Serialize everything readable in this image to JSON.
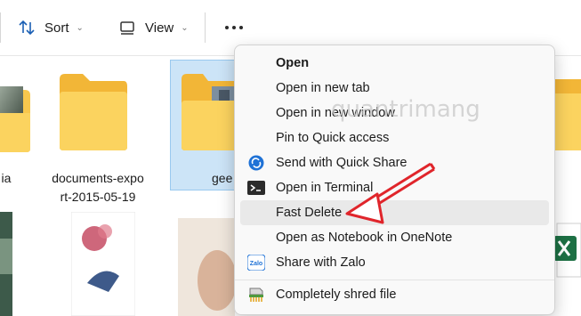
{
  "toolbar": {
    "sort_label": "Sort",
    "view_label": "View",
    "sort_icon": "sort-arrows-icon",
    "view_icon": "view-layout-icon",
    "more_icon": "more-options-icon"
  },
  "files": {
    "left_partial_name": "ia",
    "documents_name_line1": "documents-expo",
    "documents_name_line2": "rt-2015-05-19",
    "selected_name": "gee"
  },
  "menu": {
    "items": [
      {
        "label": "Open",
        "icon": ""
      },
      {
        "label": "Open in new tab",
        "icon": ""
      },
      {
        "label": "Open in new window",
        "icon": ""
      },
      {
        "label": "Pin to Quick access",
        "icon": ""
      },
      {
        "label": "Send with Quick Share",
        "icon": "quick-share-icon"
      },
      {
        "label": "Open in Terminal",
        "icon": "terminal-icon"
      },
      {
        "label": "Fast Delete",
        "icon": ""
      },
      {
        "label": "Open as Notebook in OneNote",
        "icon": ""
      },
      {
        "label": "Share with Zalo",
        "icon": "zalo-icon"
      },
      {
        "label": "Completely shred file",
        "icon": "shredder-icon"
      }
    ],
    "zalo_icon_text": "Zalo"
  },
  "watermark": "quantrimang",
  "colors": {
    "folder": "#f8c74d",
    "selection": "#cce4f7",
    "arrow": "#e0252b",
    "quick_share": "#1f72d6"
  }
}
